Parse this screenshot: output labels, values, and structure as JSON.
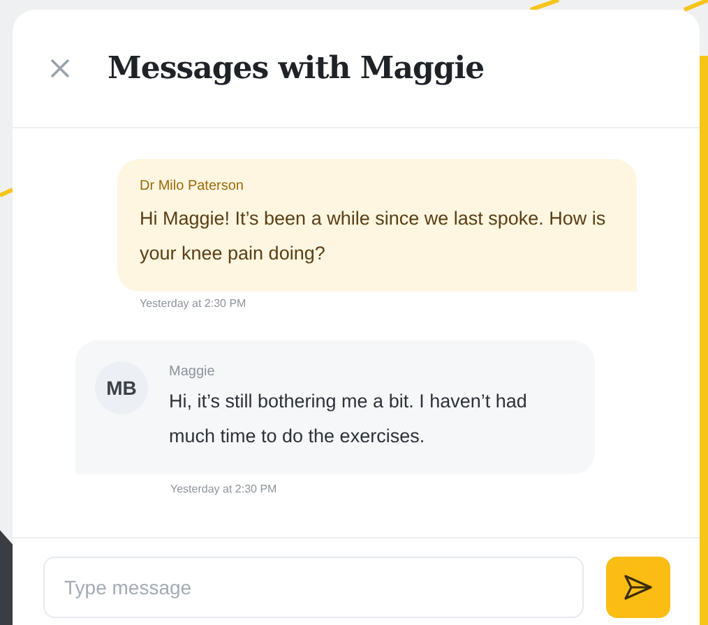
{
  "dialog": {
    "title": "Messages with Maggie"
  },
  "messages": [
    {
      "kind": "outgoing",
      "sender": "Dr Milo Paterson",
      "text": "Hi Maggie! It’s been a while since we last spoke. How is your knee pain doing?",
      "time": "Yesterday at 2:30 PM"
    },
    {
      "kind": "incoming",
      "sender": "Maggie",
      "initials": "MB",
      "text": "Hi, it’s still bothering me a bit. I haven’t had much time to do the exercises.",
      "time": "Yesterday at 2:30 PM"
    }
  ],
  "composer": {
    "placeholder": "Type message"
  }
}
